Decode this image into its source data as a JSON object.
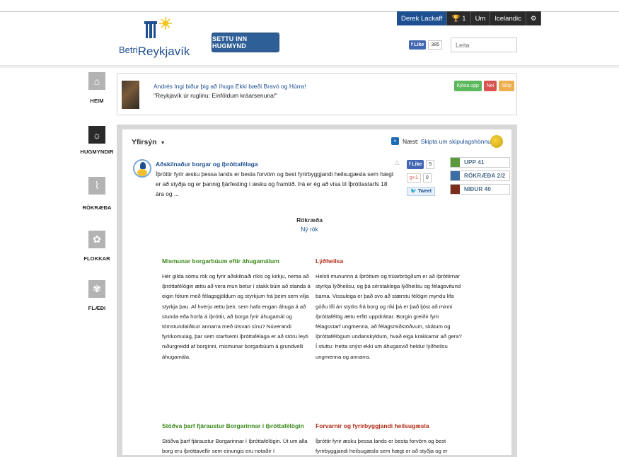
{
  "header": {
    "logo": {
      "word1": "Betri",
      "word2": "Reykjavík"
    },
    "submit_button": "SETTU INN HUGMYND",
    "topbar": {
      "user": "Derek Lackaff",
      "badge_count": "1",
      "about": "Um",
      "language": "Icelandic"
    },
    "facebook": {
      "like": "Like",
      "count": "385"
    },
    "search": {
      "placeholder": "Leita"
    }
  },
  "leftnav": {
    "items": [
      {
        "label": "HEIM",
        "icon": "home-icon"
      },
      {
        "label": "HUGMYNDIR",
        "icon": "lightbulb-icon"
      },
      {
        "label": "RÖKRÆÐA",
        "icon": "discussion-icon"
      },
      {
        "label": "FLOKKAR",
        "icon": "flower-icon"
      },
      {
        "label": "FLÆÐI",
        "icon": "flow-icon"
      }
    ]
  },
  "notice": {
    "prefix": "Andrés Ingi biður þig að íhuga ",
    "options": "Ekki bæði Bravó og Húrra!",
    "quote": "\"Reykjavík úr ruglinu: Einföldum kráarsenuna!\"",
    "buttons": {
      "yes": "Kjósa upp",
      "no": "Nei",
      "skip": "Skip"
    }
  },
  "main": {
    "section": "Yfirsýn",
    "next": {
      "label": "Næst:",
      "link": "Skipta um skipulagshönnuði"
    },
    "idea": {
      "title": "Aðskilnaður borgar og íþróttafélaga",
      "description": "Íþróttir fyrir æsku þessa lands er besta forvörn og best fyrirbyggjandi heilsugæsla sem hægt er að styðja og er þannig fjárfesting í æsku og framtíð. Þá er ég að vísa til Íþróttastarfs 18 ára og ..."
    },
    "share": {
      "fb_like": "Like",
      "fb_count": "5",
      "gplus": "+1",
      "gplus_count": "0",
      "tweet": "Tweet"
    },
    "stats": [
      {
        "label": "UPP 41",
        "color": "#5a9a3a"
      },
      {
        "label": "RÖKRÆÐA 2/2",
        "color": "#3a6ea5"
      },
      {
        "label": "NIÐUR 40",
        "color": "#7a2e1a"
      }
    ],
    "rokraeda": {
      "title": "Rökræða",
      "new": "Ný rök"
    },
    "arguments": {
      "pro1": {
        "title": "Mismunar borgarbúum eftir áhugamálum",
        "text": "Hér gilda sömu rök og fyrir aðskilnaði ríkis og kirkju, nema að íþróttafélögin ættu að vera mun betur í stakk búin að standa á eigin fótum með félagsgjöldum og styrkjum frá þeim sem vilja styrkja þau. Af hverju ættu þeir, sem hafa engan áhuga á að stunda eða horfa á íþróttir, að borga fyrir áhugamál og tómstundaiðkun annarra með útsvari sínu? Núverandi fyrirkomulag, þar sem starfsemi íþróttafélaga er að stóru leyti niðurgreidd af borginni, mismunar borgarbúum á grundvelli áhugamála."
      },
      "con1": {
        "title": "Lýðheilsa",
        "text": "Helsti munurinn á íþróttum og trúarbrögðum er að íþróttirnar styrkja lýðheilsu, og þá sérstaklega lýðheilsu og félagsvitund barna. Vissulega er það svo að stærstu félögin myndu lifa góðu lífi án styrks frá borg og ríki þá er það ljóst að minni íþróttafélög ættu erfitt uppdráttar. Borgin greiðir fyrir félagsstarf ungmenna, að félagsmiðstöðvum, skátum og íþróttafélögum undanskyldum, hvað eiga krakkarnir að gera? Í stuttu: Þetta snýst ekki um áhugasvið heldur lýðheilsu ungmenna og annarra."
      },
      "pro2": {
        "title": "Stöðva þarf fjáraustur Borgarinnar í íþróttafélögin",
        "text": "Stöðva þarf fjáraustur Borgarinnar í íþróttafélögin. Út um alla borg eru íþróttavellir sem einungis eru notaðir í"
      },
      "con2": {
        "title": "Forvarnir og fyrirbyggjandi heilsugæsla",
        "text": "Íþróttir fyrir æsku þessa lands er besta forvörn og best fyrirbyggjandi heilsugæsla sem hægt er að styðja og er"
      }
    }
  }
}
